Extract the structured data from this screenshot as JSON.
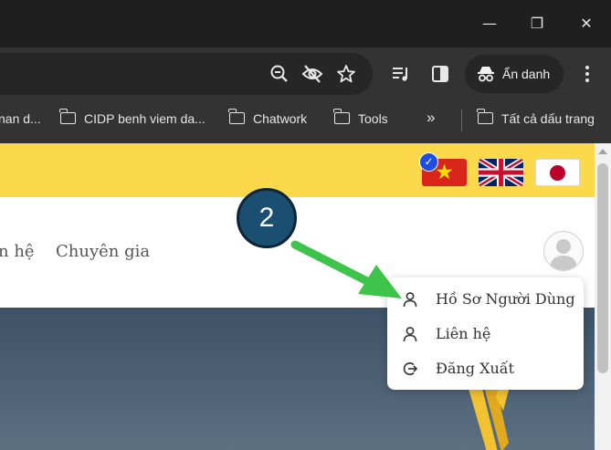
{
  "window_controls": {
    "minimize": "—",
    "restore": "❐",
    "close": "✕"
  },
  "toolbar": {
    "icons": [
      "zoom-out-icon",
      "eye-off-icon",
      "star-icon",
      "media-control-icon",
      "side-panel-icon",
      "more-icon"
    ],
    "incognito_label": "Ẩn danh"
  },
  "bookmarks": {
    "items": [
      "nan d...",
      "CIDP benh viem da...",
      "Chatwork",
      "Tools"
    ],
    "overflow": "»",
    "all_bookmarks": "Tất cả dấu trang"
  },
  "site": {
    "languages": [
      "Vietnamese",
      "English",
      "Japanese"
    ],
    "language_check": "✓",
    "nav_links": [
      "n hệ",
      "Chuyên gia"
    ]
  },
  "user_menu": {
    "items": [
      {
        "label": "Hồ Sơ Người Dùng",
        "icon": "user-icon"
      },
      {
        "label": "Liên hệ",
        "icon": "user-icon"
      },
      {
        "label": "Đăng Xuất",
        "icon": "logout-icon"
      }
    ]
  },
  "annotation": {
    "step": "2"
  },
  "colors": {
    "accent": "#fcd94a",
    "callout": "#1b4f72",
    "arrow": "#3ec44a",
    "hero": "#4a5f72"
  }
}
